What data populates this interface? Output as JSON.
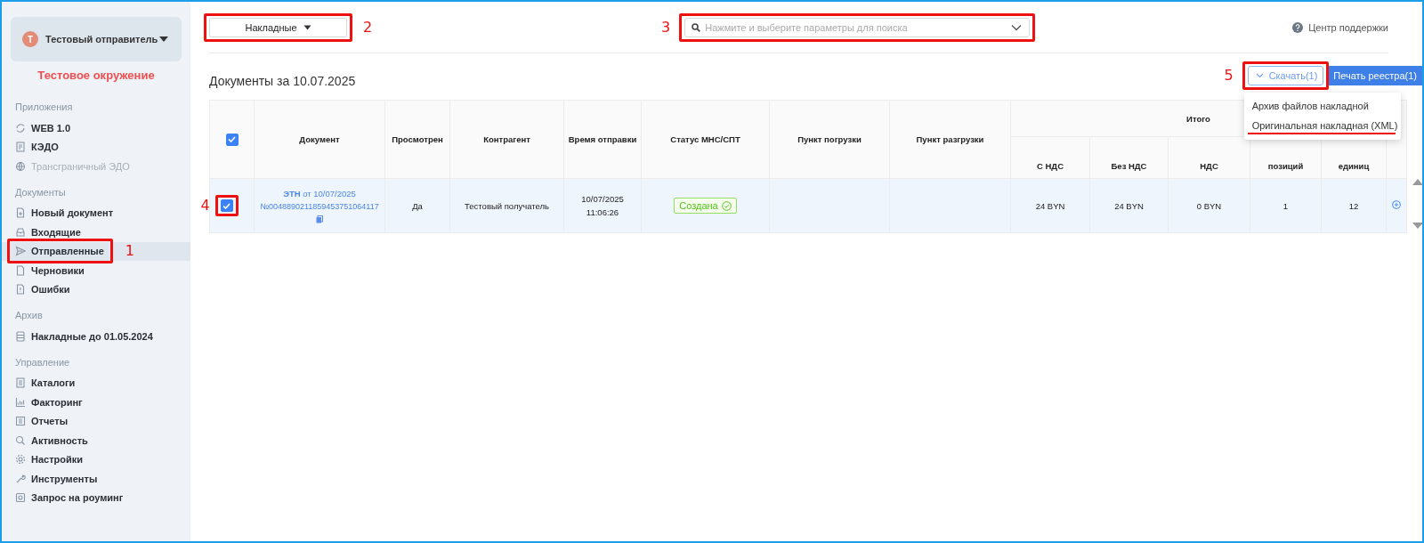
{
  "sidebar": {
    "account": {
      "initial": "Т",
      "name": "Тестовый отправитель"
    },
    "environment": "Тестовое окружение",
    "sections": [
      {
        "title": "Приложения",
        "items": [
          {
            "label": "WEB 1.0",
            "selected": false,
            "disabled": false
          },
          {
            "label": "КЭДО",
            "selected": false,
            "disabled": false
          },
          {
            "label": "Трансграничный ЭДО",
            "selected": false,
            "disabled": true
          }
        ]
      },
      {
        "title": "Документы",
        "items": [
          {
            "label": "Новый документ",
            "selected": false,
            "disabled": false
          },
          {
            "label": "Входящие",
            "selected": false,
            "disabled": false
          },
          {
            "label": "Отправленные",
            "selected": true,
            "disabled": false,
            "annotation": {
              "number": "1",
              "kind": "trailing"
            }
          },
          {
            "label": "Черновики",
            "selected": false,
            "disabled": false
          },
          {
            "label": "Ошибки",
            "selected": false,
            "disabled": false
          }
        ]
      },
      {
        "title": "Архив",
        "items": [
          {
            "label": "Накладные до 01.05.2024",
            "selected": false,
            "disabled": false
          }
        ]
      },
      {
        "title": "Управление",
        "items": [
          {
            "label": "Каталоги",
            "selected": false,
            "disabled": false
          },
          {
            "label": "Факторинг",
            "selected": false,
            "disabled": false
          },
          {
            "label": "Отчеты",
            "selected": false,
            "disabled": false
          },
          {
            "label": "Активность",
            "selected": false,
            "disabled": false
          },
          {
            "label": "Настройки",
            "selected": false,
            "disabled": false
          },
          {
            "label": "Инструменты",
            "selected": false,
            "disabled": false
          },
          {
            "label": "Запрос на роуминг",
            "selected": false,
            "disabled": false
          }
        ]
      }
    ]
  },
  "toolbar": {
    "document_type": {
      "value": "Накладные",
      "annotation": {
        "number": "2",
        "kind": "trailing"
      }
    },
    "search": {
      "placeholder": "Нажмите и выберите параметры для поиска",
      "annotation": {
        "number": "3",
        "kind": "leading"
      }
    },
    "support_link": "Центр поддержки"
  },
  "heading": "Документы за 10.07.2025",
  "actions": {
    "download": {
      "label": "Скачать(1)",
      "expanded": true,
      "annotation": {
        "number": "5",
        "kind": "leading"
      }
    },
    "print": "Печать реестра(1)"
  },
  "download_menu": [
    {
      "label": "Архив файлов накладной",
      "underlined": false
    },
    {
      "label": "Оригинальная накладная (XML)",
      "underlined": true
    }
  ],
  "table": {
    "select_all_checked": true,
    "columns": [
      "Документ",
      "Просмотрен",
      "Контрагент",
      "Время отправки",
      "Статус МНС/СПТ",
      "Пункт погрузки",
      "Пункт разгрузки"
    ],
    "total_group": {
      "label": "Итого",
      "columns": [
        "С НДС",
        "Без НДС",
        "НДС",
        "позиций",
        "единиц"
      ]
    },
    "rows": [
      {
        "checked": true,
        "selected": true,
        "annotation": {
          "number": "4",
          "kind": "leading"
        },
        "document": {
          "title": "**ЭТН** от 10/07/2025",
          "number": "№0048890211859453751064117"
        },
        "viewed": "Да",
        "counterparty": "Тестовый получатель",
        "sent": [
          "10/07/2025",
          "11:06:26"
        ],
        "status": "Создана",
        "totals": [
          "24 BYN",
          "24 BYN",
          "0 BYN",
          "1",
          "12"
        ]
      }
    ]
  }
}
